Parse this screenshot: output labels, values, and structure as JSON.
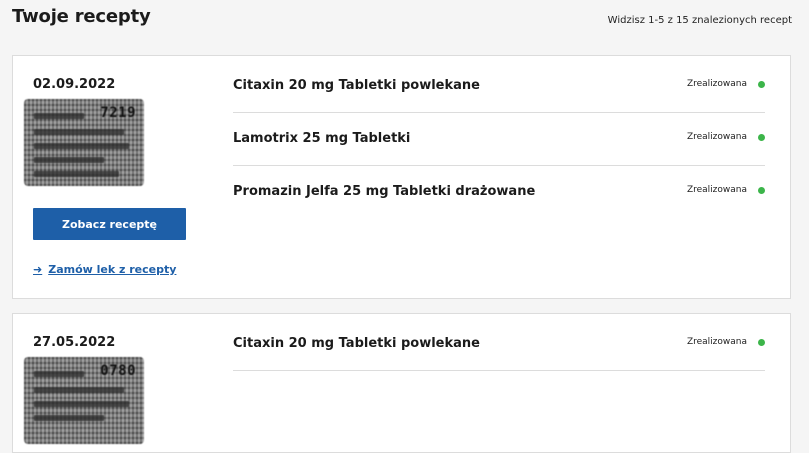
{
  "header": {
    "title": "Twoje recepty",
    "results_count": "Widzisz 1-5 z 15 znalezionych recept"
  },
  "colors": {
    "primary": "#1e5fa8",
    "status_green": "#3cb54a"
  },
  "prescriptions": [
    {
      "date": "02.09.2022",
      "thumbnail_code": "7219",
      "view_button_label": "Zobacz receptę",
      "order_link_label": "Zamów lek z recepty",
      "medications": [
        {
          "name": "Citaxin 20 mg Tabletki powlekane",
          "status": "Zrealizowana"
        },
        {
          "name": "Lamotrix 25 mg Tabletki",
          "status": "Zrealizowana"
        },
        {
          "name": "Promazin Jelfa 25 mg Tabletki drażowane",
          "status": "Zrealizowana"
        }
      ]
    },
    {
      "date": "27.05.2022",
      "thumbnail_code": "0780",
      "medications": [
        {
          "name": "Citaxin 20 mg Tabletki powlekane",
          "status": "Zrealizowana"
        }
      ]
    }
  ]
}
